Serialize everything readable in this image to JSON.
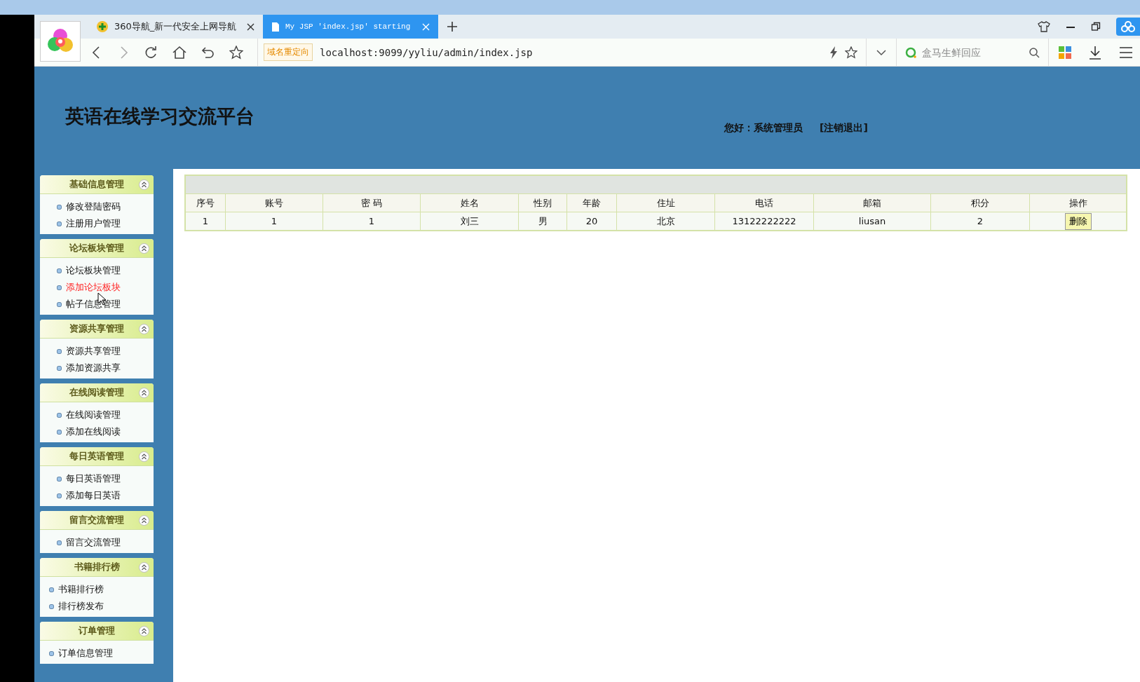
{
  "browser": {
    "tabs": [
      {
        "label": "360导航_新一代安全上网导航",
        "selected": false
      },
      {
        "label": "My JSP 'index.jsp' starting",
        "selected": true
      }
    ],
    "redirect_badge": "域名重定向",
    "url": "localhost:9099/yyliu/admin/index.jsp",
    "search": {
      "placeholder": "盒马生鲜回应"
    }
  },
  "header": {
    "title": "英语在线学习交流平台",
    "greeting": "您好：系统管理员",
    "logout": "[注销退出]"
  },
  "sidebar": [
    {
      "title": "基础信息管理",
      "items": [
        {
          "label": "修改登陆密码",
          "selected": false
        },
        {
          "label": "注册用户管理",
          "selected": false
        }
      ]
    },
    {
      "title": "论坛板块管理",
      "items": [
        {
          "label": "论坛板块管理",
          "selected": false
        },
        {
          "label": "添加论坛板块",
          "selected": true
        },
        {
          "label": "帖子信息管理",
          "selected": false
        }
      ]
    },
    {
      "title": "资源共享管理",
      "items": [
        {
          "label": "资源共享管理",
          "selected": false
        },
        {
          "label": "添加资源共享",
          "selected": false
        }
      ]
    },
    {
      "title": "在线阅读管理",
      "items": [
        {
          "label": "在线阅读管理",
          "selected": false
        },
        {
          "label": "添加在线阅读",
          "selected": false
        }
      ]
    },
    {
      "title": "每日英语管理",
      "items": [
        {
          "label": "每日英语管理",
          "selected": false
        },
        {
          "label": "添加每日英语",
          "selected": false
        }
      ]
    },
    {
      "title": "留言交流管理",
      "items": [
        {
          "label": "留言交流管理",
          "selected": false
        }
      ]
    },
    {
      "title": "书籍排行榜",
      "items": [
        {
          "label": "书籍排行榜",
          "selected": false
        },
        {
          "label": "排行榜发布",
          "selected": false
        }
      ]
    },
    {
      "title": "订单管理",
      "items": [
        {
          "label": "订单信息管理",
          "selected": false
        }
      ]
    }
  ],
  "table": {
    "columns": [
      "序号",
      "账号",
      "密 码",
      "姓名",
      "性别",
      "年龄",
      "住址",
      "电话",
      "邮箱",
      "积分",
      "操作"
    ],
    "rows": [
      {
        "cells": [
          "1",
          "1",
          "1",
          "刘三",
          "男",
          "20",
          "北京",
          "13122222222",
          "liusan",
          "2"
        ],
        "action": "删除"
      }
    ]
  }
}
